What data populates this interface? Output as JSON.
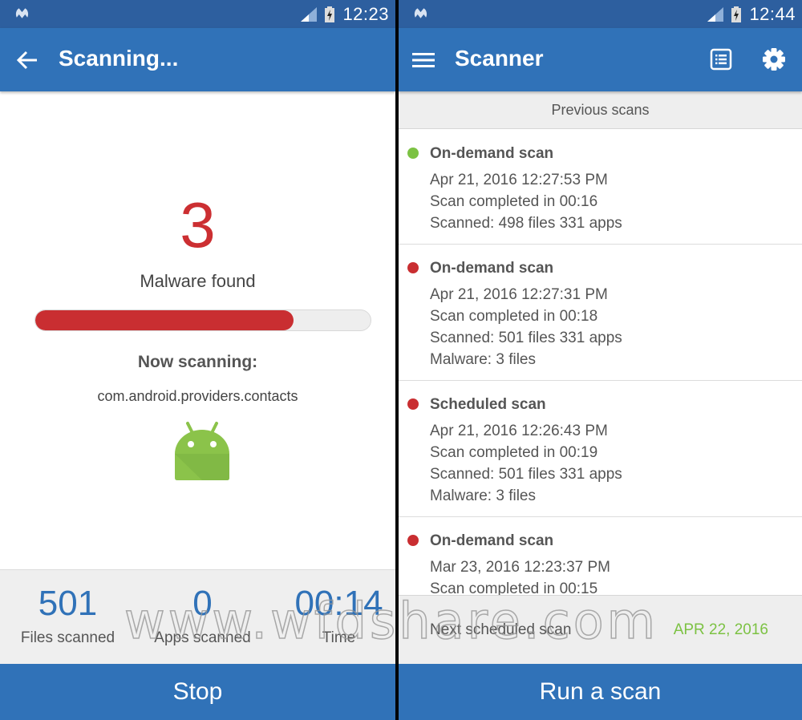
{
  "left": {
    "status_bar": {
      "time": "12:23"
    },
    "app_bar": {
      "title": "Scanning..."
    },
    "malware": {
      "count": "3",
      "label": "Malware found"
    },
    "progress": {
      "percent": 77,
      "color": "#c92e31"
    },
    "now_scanning": {
      "label": "Now scanning:",
      "package": "com.android.providers.contacts"
    },
    "stats": [
      {
        "value": "501",
        "label": "Files scanned"
      },
      {
        "value": "0",
        "label": "Apps scanned"
      },
      {
        "value": "00:14",
        "label": "Time"
      }
    ],
    "stop_button": "Stop"
  },
  "right": {
    "status_bar": {
      "time": "12:44"
    },
    "app_bar": {
      "title": "Scanner"
    },
    "section_header": "Previous scans",
    "scans": [
      {
        "status": "clean",
        "name": "On-demand scan",
        "lines": [
          "Apr 21, 2016 12:27:53 PM",
          "Scan completed in 00:16",
          "Scanned: 498 files 331 apps"
        ]
      },
      {
        "status": "malware",
        "name": "On-demand scan",
        "lines": [
          "Apr 21, 2016 12:27:31 PM",
          "Scan completed in 00:18",
          "Scanned: 501 files 331 apps",
          "Malware: 3 files"
        ]
      },
      {
        "status": "malware",
        "name": "Scheduled scan",
        "lines": [
          "Apr 21, 2016 12:26:43 PM",
          "Scan completed in 00:19",
          "Scanned: 501 files 331 apps",
          "Malware: 3 files"
        ]
      },
      {
        "status": "malware",
        "name": "On-demand scan",
        "lines": [
          "Mar 23, 2016 12:23:37 PM",
          "Scan completed in 00:15"
        ]
      }
    ],
    "next_scheduled": {
      "label": "Next scheduled scan",
      "date": "APR 22, 2016"
    },
    "run_button": "Run a scan"
  },
  "colors": {
    "primary": "#3072b8",
    "status_bar": "#2d5f9f",
    "danger": "#c92e31",
    "success": "#7cc243"
  },
  "watermark": "www.wfdshare.com"
}
